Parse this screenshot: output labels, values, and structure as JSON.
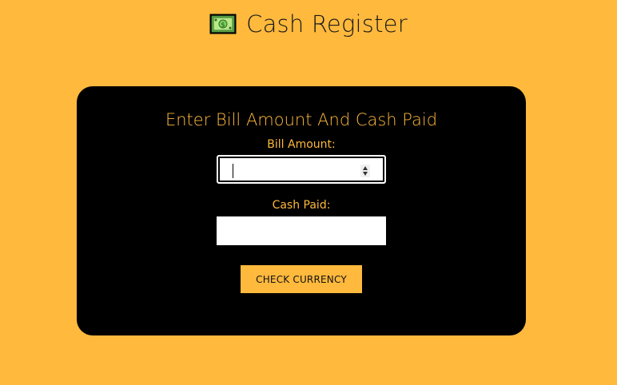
{
  "header": {
    "title": "Cash Register",
    "icon": "money-icon"
  },
  "colors": {
    "background": "#FFB93D",
    "card": "#000000",
    "accent": "#FFB93D"
  },
  "form": {
    "heading": "Enter Bill Amount And Cash Paid",
    "bill_label": "Bill Amount:",
    "bill_value": "",
    "cash_label": "Cash Paid:",
    "cash_value": "",
    "button_label": "CHECK CURRENCY"
  }
}
